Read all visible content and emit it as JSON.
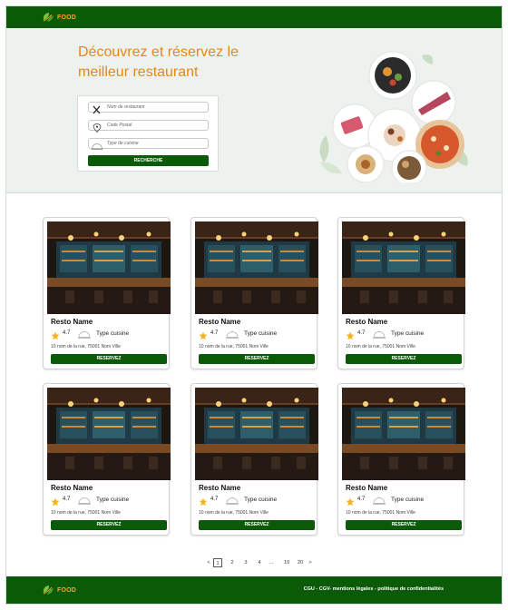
{
  "brand": {
    "logo_text": "FOOD",
    "primary_color": "#0b5a08",
    "accent_color": "#e88614"
  },
  "hero": {
    "title_line1": "Découvrez et réservez le",
    "title_line2": "meilleur restaurant"
  },
  "search": {
    "name_placeholder": "Nom de restaurant",
    "postal_placeholder": "Code Postal",
    "cuisine_placeholder": "Type de cuisine",
    "button_label": "RECHERCHE"
  },
  "cards": [
    {
      "name": "Resto Name",
      "rating": "4.7",
      "cuisine": "Type cuisine",
      "address": "10 nom de la rue, 75001 Nom Ville",
      "button_label": "RESERVEZ"
    },
    {
      "name": "Resto Name",
      "rating": "4.7",
      "cuisine": "Type cuisine",
      "address": "10 nom de la rue, 75001 Nom Ville",
      "button_label": "RESERVEZ"
    },
    {
      "name": "Resto Name",
      "rating": "4.7",
      "cuisine": "Type cuisine",
      "address": "10 nom de la rue, 75001 Nom Ville",
      "button_label": "RESERVEZ"
    },
    {
      "name": "Resto Name",
      "rating": "4.7",
      "cuisine": "Type cuisine",
      "address": "10 nom de la rue, 75001 Nom Ville",
      "button_label": "RESERVEZ"
    },
    {
      "name": "Resto Name",
      "rating": "4.7",
      "cuisine": "Type cuisine",
      "address": "10 nom de la rue, 75001 Nom Ville",
      "button_label": "RESERVEZ"
    },
    {
      "name": "Resto Name",
      "rating": "4.7",
      "cuisine": "Type cuisine",
      "address": "10 nom de la rue, 75001 Nom Ville",
      "button_label": "RESERVEZ"
    }
  ],
  "pagination": {
    "prev": "<",
    "pages": [
      "1",
      "2",
      "3",
      "4"
    ],
    "ellipsis": "...",
    "tail_pages": [
      "19",
      "20"
    ],
    "next": ">",
    "current": "1"
  },
  "footer": {
    "links": "CGU - CGV- mentions légales - politique de confidentialités"
  }
}
